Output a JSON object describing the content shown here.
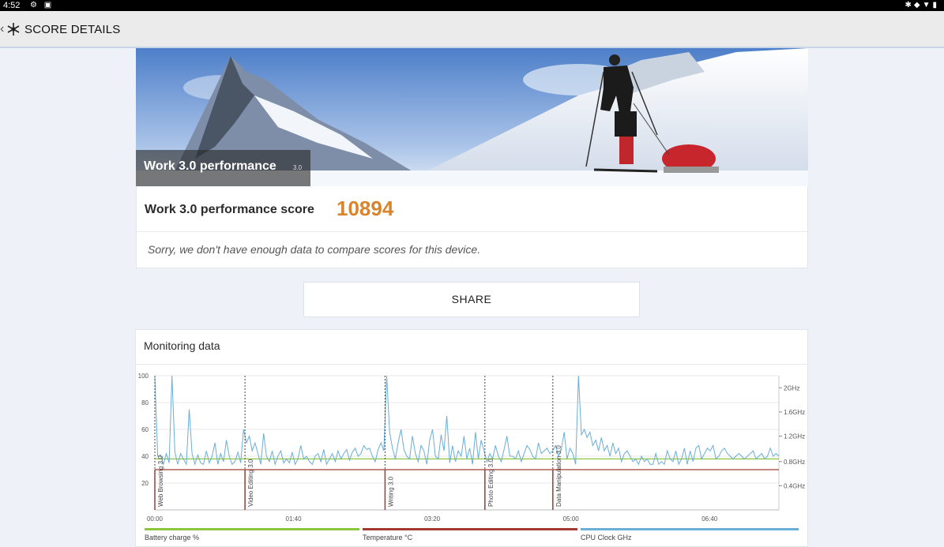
{
  "status_bar": {
    "time": "4:52"
  },
  "app_bar": {
    "title": "SCORE DETAILS"
  },
  "hero": {
    "test_name": "Work 3.0 performance",
    "version": "3.0"
  },
  "score": {
    "label": "Work 3.0 performance score",
    "value": "10894",
    "note": "Sorry, we don't have enough data to compare scores for this device."
  },
  "share": {
    "label": "SHARE"
  },
  "monitoring": {
    "title": "Monitoring data"
  },
  "colors": {
    "accent_score": "#d9842b",
    "battery": "#8cc63f",
    "temperature": "#a23a32",
    "cpu": "#6aaed6"
  },
  "chart_data": {
    "type": "line",
    "x_ticks": [
      "00:00",
      "01:40",
      "03:20",
      "05:00",
      "06:40"
    ],
    "y_left_ticks": [
      "100",
      "80",
      "60",
      "40",
      "20"
    ],
    "y_right_ticks": [
      "2GHz",
      "1.6GHz",
      "1.2GHz",
      "0.8GHz",
      "0.4GHz"
    ],
    "ylim": [
      0,
      100
    ],
    "markers": [
      {
        "label": "Web Browsing 3.0",
        "x": 0
      },
      {
        "label": "Video Editing 3.0",
        "x": 65
      },
      {
        "label": "Writing 3.0",
        "x": 166
      },
      {
        "label": "Photo Editing 3.0",
        "x": 238
      },
      {
        "label": "Data Manipulation 3.0",
        "x": 287
      }
    ],
    "x_range": [
      0,
      450
    ],
    "series": [
      {
        "name": "Battery charge %",
        "flat_value": 38
      },
      {
        "name": "Temperature °C",
        "flat_value": 30
      },
      {
        "name": "CPU Clock GHz",
        "values": [
          100,
          40,
          41,
          34,
          42,
          35,
          100,
          43,
          34,
          42,
          38,
          34,
          75,
          42,
          34,
          41,
          35,
          34,
          44,
          35,
          40,
          50,
          34,
          42,
          36,
          52,
          40,
          34,
          36,
          43,
          35,
          60,
          50,
          55,
          44,
          50,
          42,
          34,
          57,
          40,
          36,
          44,
          34,
          40,
          44,
          35,
          38,
          35,
          43,
          34,
          38,
          48,
          38,
          40,
          36,
          34,
          40,
          42,
          36,
          45,
          34,
          38,
          42,
          36,
          44,
          38,
          42,
          45,
          37,
          43,
          46,
          40,
          42,
          48,
          45,
          46,
          40,
          36,
          45,
          50,
          44,
          100,
          58,
          46,
          38,
          50,
          60,
          45,
          40,
          38,
          55,
          42,
          36,
          48,
          44,
          34,
          52,
          60,
          40,
          38,
          56,
          44,
          70,
          35,
          48,
          36,
          44,
          40,
          55,
          38,
          46,
          34,
          58,
          38,
          52,
          44,
          36,
          42,
          38,
          48,
          40,
          36,
          45,
          55,
          40,
          40,
          38,
          44,
          36,
          42,
          48,
          45,
          40,
          38,
          50,
          42,
          44,
          46,
          42,
          44,
          48,
          40,
          45,
          58,
          38,
          46,
          42,
          34,
          100,
          56,
          60,
          54,
          58,
          48,
          52,
          44,
          54,
          44,
          48,
          40,
          50,
          42,
          46,
          36,
          42,
          44,
          40,
          36,
          38,
          34,
          40,
          36,
          38,
          34,
          34,
          42,
          34,
          36,
          34,
          44,
          38,
          36,
          44,
          34,
          38,
          46,
          34,
          44,
          36,
          46,
          48,
          38,
          42,
          46,
          44,
          48,
          38,
          40,
          44,
          46,
          42,
          40,
          38,
          40,
          42,
          40,
          38,
          40,
          42,
          44,
          38,
          40,
          42,
          38,
          40,
          46,
          40,
          42,
          40
        ]
      }
    ],
    "legend": [
      "Battery charge %",
      "Temperature °C",
      "CPU Clock GHz"
    ]
  }
}
